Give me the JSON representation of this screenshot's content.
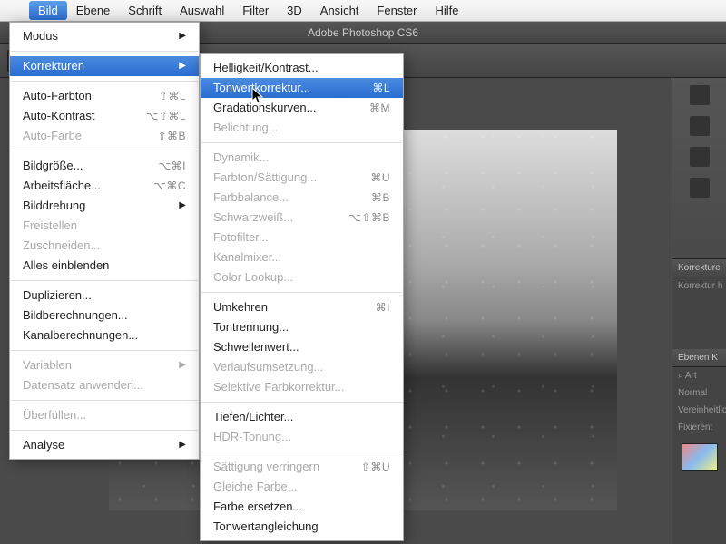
{
  "menubar": {
    "apple": "",
    "items": [
      "Bild",
      "Ebene",
      "Schrift",
      "Auswahl",
      "Filter",
      "3D",
      "Ansicht",
      "Fenster",
      "Hilfe"
    ],
    "active_index": 0
  },
  "app_title": "Adobe Photoshop CS6",
  "menu1": {
    "groups": [
      [
        {
          "label": "Modus",
          "arrow": true
        }
      ],
      [
        {
          "label": "Korrekturen",
          "arrow": true,
          "hl": true
        }
      ],
      [
        {
          "label": "Auto-Farbton",
          "shortcut": "⇧⌘L"
        },
        {
          "label": "Auto-Kontrast",
          "shortcut": "⌥⇧⌘L"
        },
        {
          "label": "Auto-Farbe",
          "shortcut": "⇧⌘B",
          "disabled": true
        }
      ],
      [
        {
          "label": "Bildgröße...",
          "shortcut": "⌥⌘I"
        },
        {
          "label": "Arbeitsfläche...",
          "shortcut": "⌥⌘C"
        },
        {
          "label": "Bilddrehung",
          "arrow": true
        },
        {
          "label": "Freistellen",
          "disabled": true
        },
        {
          "label": "Zuschneiden...",
          "disabled": true
        },
        {
          "label": "Alles einblenden"
        }
      ],
      [
        {
          "label": "Duplizieren..."
        },
        {
          "label": "Bildberechnungen..."
        },
        {
          "label": "Kanalberechnungen..."
        }
      ],
      [
        {
          "label": "Variablen",
          "arrow": true,
          "disabled": true
        },
        {
          "label": "Datensatz anwenden...",
          "disabled": true
        }
      ],
      [
        {
          "label": "Überfüllen...",
          "disabled": true
        }
      ],
      [
        {
          "label": "Analyse",
          "arrow": true
        }
      ]
    ]
  },
  "menu2": {
    "groups": [
      [
        {
          "label": "Helligkeit/Kontrast..."
        },
        {
          "label": "Tonwertkorrektur...",
          "shortcut": "⌘L",
          "hl": true
        },
        {
          "label": "Gradationskurven...",
          "shortcut": "⌘M"
        },
        {
          "label": "Belichtung...",
          "disabled": true
        }
      ],
      [
        {
          "label": "Dynamik...",
          "disabled": true
        },
        {
          "label": "Farbton/Sättigung...",
          "shortcut": "⌘U",
          "disabled": true
        },
        {
          "label": "Farbbalance...",
          "shortcut": "⌘B",
          "disabled": true
        },
        {
          "label": "Schwarzweiß...",
          "shortcut": "⌥⇧⌘B",
          "disabled": true
        },
        {
          "label": "Fotofilter...",
          "disabled": true
        },
        {
          "label": "Kanalmixer...",
          "disabled": true
        },
        {
          "label": "Color Lookup...",
          "disabled": true
        }
      ],
      [
        {
          "label": "Umkehren",
          "shortcut": "⌘I"
        },
        {
          "label": "Tontrennung..."
        },
        {
          "label": "Schwellenwert..."
        },
        {
          "label": "Verlaufsumsetzung...",
          "disabled": true
        },
        {
          "label": "Selektive Farbkorrektur...",
          "disabled": true
        }
      ],
      [
        {
          "label": "Tiefen/Lichter..."
        },
        {
          "label": "HDR-Tonung...",
          "disabled": true
        }
      ],
      [
        {
          "label": "Sättigung verringern",
          "shortcut": "⇧⌘U",
          "disabled": true
        },
        {
          "label": "Gleiche Farbe...",
          "disabled": true
        },
        {
          "label": "Farbe ersetzen..."
        },
        {
          "label": "Tonwertangleichung"
        }
      ]
    ]
  },
  "panels": {
    "top_header": "Korrekture",
    "top_sub": "Korrektur h",
    "layers_header": "Ebenen   K",
    "kind_label": "Art",
    "blend": "Normal",
    "unify": "Vereinheitlic",
    "lock": "Fixieren:"
  },
  "search_icon": "⌕"
}
